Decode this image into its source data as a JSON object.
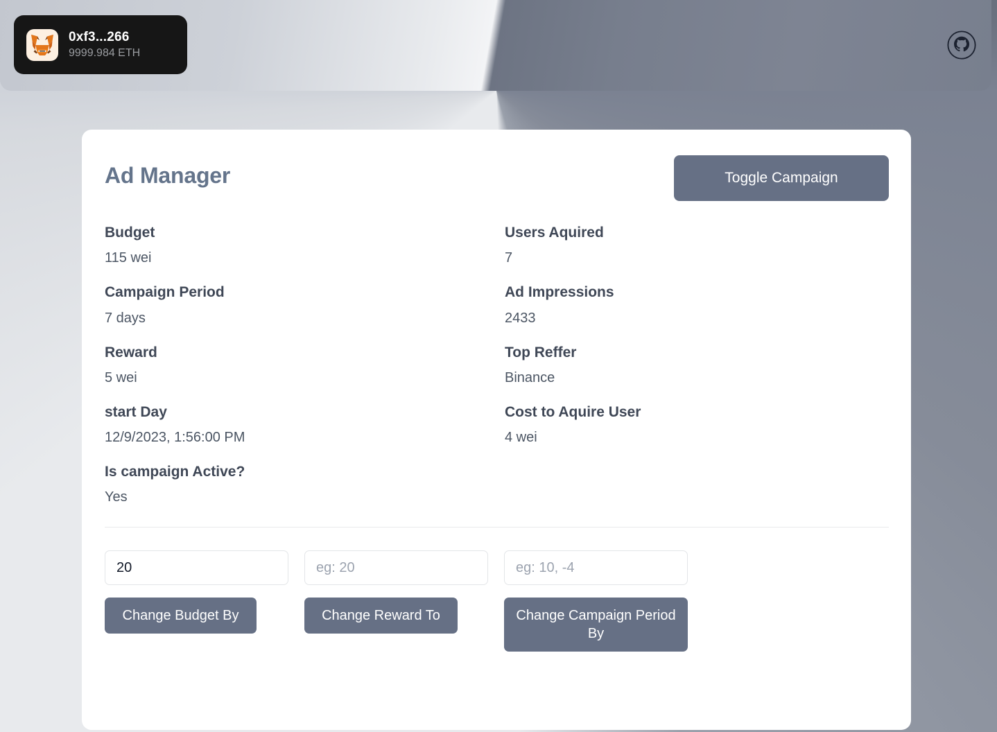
{
  "wallet": {
    "icon": "metamask-fox-icon",
    "address": "0xf3...266",
    "balance": "9999.984 ETH"
  },
  "header": {
    "github_icon": "github-icon"
  },
  "card": {
    "title": "Ad Manager",
    "toggle_button_label": "Toggle Campaign",
    "stats_left": [
      {
        "label": "Budget",
        "value": "115 wei"
      },
      {
        "label": "Campaign Period",
        "value": "7 days"
      },
      {
        "label": "Reward",
        "value": "5 wei"
      },
      {
        "label": "start Day",
        "value": "12/9/2023, 1:56:00 PM"
      },
      {
        "label": "Is campaign Active?",
        "value": "Yes"
      }
    ],
    "stats_right": [
      {
        "label": "Users Aquired",
        "value": "7"
      },
      {
        "label": "Ad Impressions",
        "value": "2433"
      },
      {
        "label": "Top Reffer",
        "value": "Binance"
      },
      {
        "label": "Cost to Aquire User",
        "value": "4 wei"
      }
    ],
    "controls": [
      {
        "input_value": "20",
        "input_placeholder": "",
        "button_label": "Change Budget By"
      },
      {
        "input_value": "",
        "input_placeholder": "eg: 20",
        "button_label": "Change Reward To"
      },
      {
        "input_value": "",
        "input_placeholder": "eg: 10, -4",
        "button_label": "Change Campaign Period By"
      }
    ]
  },
  "colors": {
    "accent": "#667085",
    "title": "#64748b",
    "label": "#3f4756",
    "value": "#4b5563",
    "card_bg": "#ffffff",
    "pill_bg": "#161616",
    "divider": "#e9eaec"
  }
}
